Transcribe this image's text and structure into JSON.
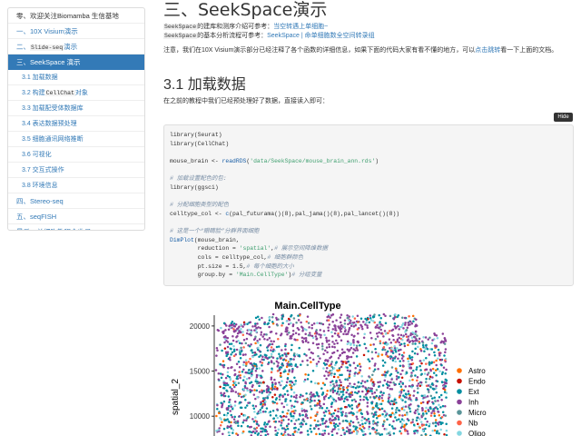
{
  "toc": {
    "items": [
      {
        "label": "零、欢迎关注Biomamba 生信基地",
        "level": 1,
        "state": "first"
      },
      {
        "label": "一、10X Visium演示",
        "level": 1
      },
      {
        "label_pre": "二、",
        "label_code": "Slide-seq",
        "label_post": "演示",
        "level": 1
      },
      {
        "label": "三、SeekSpace 演示",
        "level": 1,
        "state": "active"
      },
      {
        "label": "3.1 加载数据",
        "level": 2
      },
      {
        "label_pre": "3.2 构建",
        "label_code": "CellChat",
        "label_post": "对象",
        "level": 2
      },
      {
        "label": "3.3 加载配受体数据库",
        "level": 2
      },
      {
        "label": "3.4 表达数据预处理",
        "level": 2
      },
      {
        "label": "3.5 细胞通讯网络推断",
        "level": 2
      },
      {
        "label": "3.6 可视化",
        "level": 2
      },
      {
        "label": "3.7 交互式操作",
        "level": 2
      },
      {
        "label": "3.8 环境信息",
        "level": 2
      },
      {
        "label": "四、Stereo-seq",
        "level": 1
      },
      {
        "label": "五、seqFISH",
        "level": 1
      },
      {
        "label": "最后、单细胞教程全收录",
        "level": 1
      }
    ]
  },
  "main": {
    "title": "三、SeekSpace演示",
    "intro1": {
      "code": "SeekSpace",
      "text": "的建库和测序介绍可参考：",
      "link": "当空转遇上单细胞~"
    },
    "intro2": {
      "code": "SeekSpace",
      "text": "的基本分析流程可参考：",
      "link": "SeekSpace | 命单细胞数全空间转录组"
    },
    "note_pre": "注意，我们在10X Visium演示部分已经注释了各个函数的详细信息，如果下面的代码大家有看不懂的地方，可以",
    "note_link": "点击跳转",
    "note_post": "看一下上面的文档。",
    "section_title": "3.1 加载数据",
    "section_desc": "在之前的教程中我们已经预处理好了数据，直接读入即可：",
    "hide_button": "Hide"
  },
  "code_lines": [
    [
      {
        "t": "library(Seurat)",
        "c": "kw"
      }
    ],
    [
      {
        "t": "library(CellChat)",
        "c": "kw"
      }
    ],
    [
      {
        "t": "",
        "c": "kw"
      }
    ],
    [
      {
        "t": "mouse_brain <- ",
        "c": "kw"
      },
      {
        "t": "readRDS",
        "c": "nb"
      },
      {
        "t": "(",
        "c": "kw"
      },
      {
        "t": "'data/SeekSpace/mouse_brain_ann.rds'",
        "c": "st"
      },
      {
        "t": ")",
        "c": "kw"
      }
    ],
    [
      {
        "t": "",
        "c": "kw"
      }
    ],
    [
      {
        "t": "# 加载设置配色的包:",
        "c": "cm"
      }
    ],
    [
      {
        "t": "library(ggsci)",
        "c": "kw"
      }
    ],
    [
      {
        "t": "",
        "c": "kw"
      }
    ],
    [
      {
        "t": "# 分配细胞类型的配色",
        "c": "cm"
      }
    ],
    [
      {
        "t": "celltype_col <- ",
        "c": "kw"
      },
      {
        "t": "c",
        "c": "nb"
      },
      {
        "t": "(pal_futurama()(8),pal_jama()(8),pal_lancet()(8))",
        "c": "kw"
      }
    ],
    [
      {
        "t": "",
        "c": "kw"
      }
    ],
    [
      {
        "t": "# 这是一个“眼睛脸”分群界面细胞",
        "c": "cm"
      }
    ],
    [
      {
        "t": "DimPlot",
        "c": "nb"
      },
      {
        "t": "(mouse_brain,",
        "c": "kw"
      }
    ],
    [
      {
        "t": "        reduction = ",
        "c": "kw"
      },
      {
        "t": "'spatial'",
        "c": "st"
      },
      {
        "t": ",",
        "c": "kw"
      },
      {
        "t": "# 展示空间降维数据",
        "c": "cm"
      }
    ],
    [
      {
        "t": "        cols = celltype_col,",
        "c": "kw"
      },
      {
        "t": "# 细胞群颜色",
        "c": "cm"
      }
    ],
    [
      {
        "t": "        pt.size = 1.5,",
        "c": "kw"
      },
      {
        "t": "# 每个细胞的大小",
        "c": "cm"
      }
    ],
    [
      {
        "t": "        group.by = ",
        "c": "kw"
      },
      {
        "t": "'Main.CellType'",
        "c": "st"
      },
      {
        "t": ")",
        "c": "kw"
      },
      {
        "t": "# 分组变量",
        "c": "cm"
      }
    ]
  ],
  "chart_data": {
    "type": "scatter",
    "title": "Main.CellType",
    "xlabel": "",
    "ylabel": "spatial_2",
    "y_ticks": [
      20000,
      15000,
      10000
    ],
    "ylim": [
      7800,
      21500
    ],
    "xlim": [
      0,
      30000
    ],
    "legend_position": "right",
    "series": [
      {
        "name": "Astro",
        "color": "#ff6f00"
      },
      {
        "name": "Endo",
        "color": "#c71000"
      },
      {
        "name": "Ext",
        "color": "#008ea0"
      },
      {
        "name": "Inh",
        "color": "#8a4198"
      },
      {
        "name": "Micro",
        "color": "#5a9599"
      },
      {
        "name": "Nb",
        "color": "#ff6348"
      },
      {
        "name": "Oligo",
        "color": "#84d7e1"
      }
    ]
  },
  "colors": {
    "accent": "#337ab7",
    "code_bg": "#f5f5f5",
    "comment": "#7a8fa6",
    "string": "#40a070"
  }
}
